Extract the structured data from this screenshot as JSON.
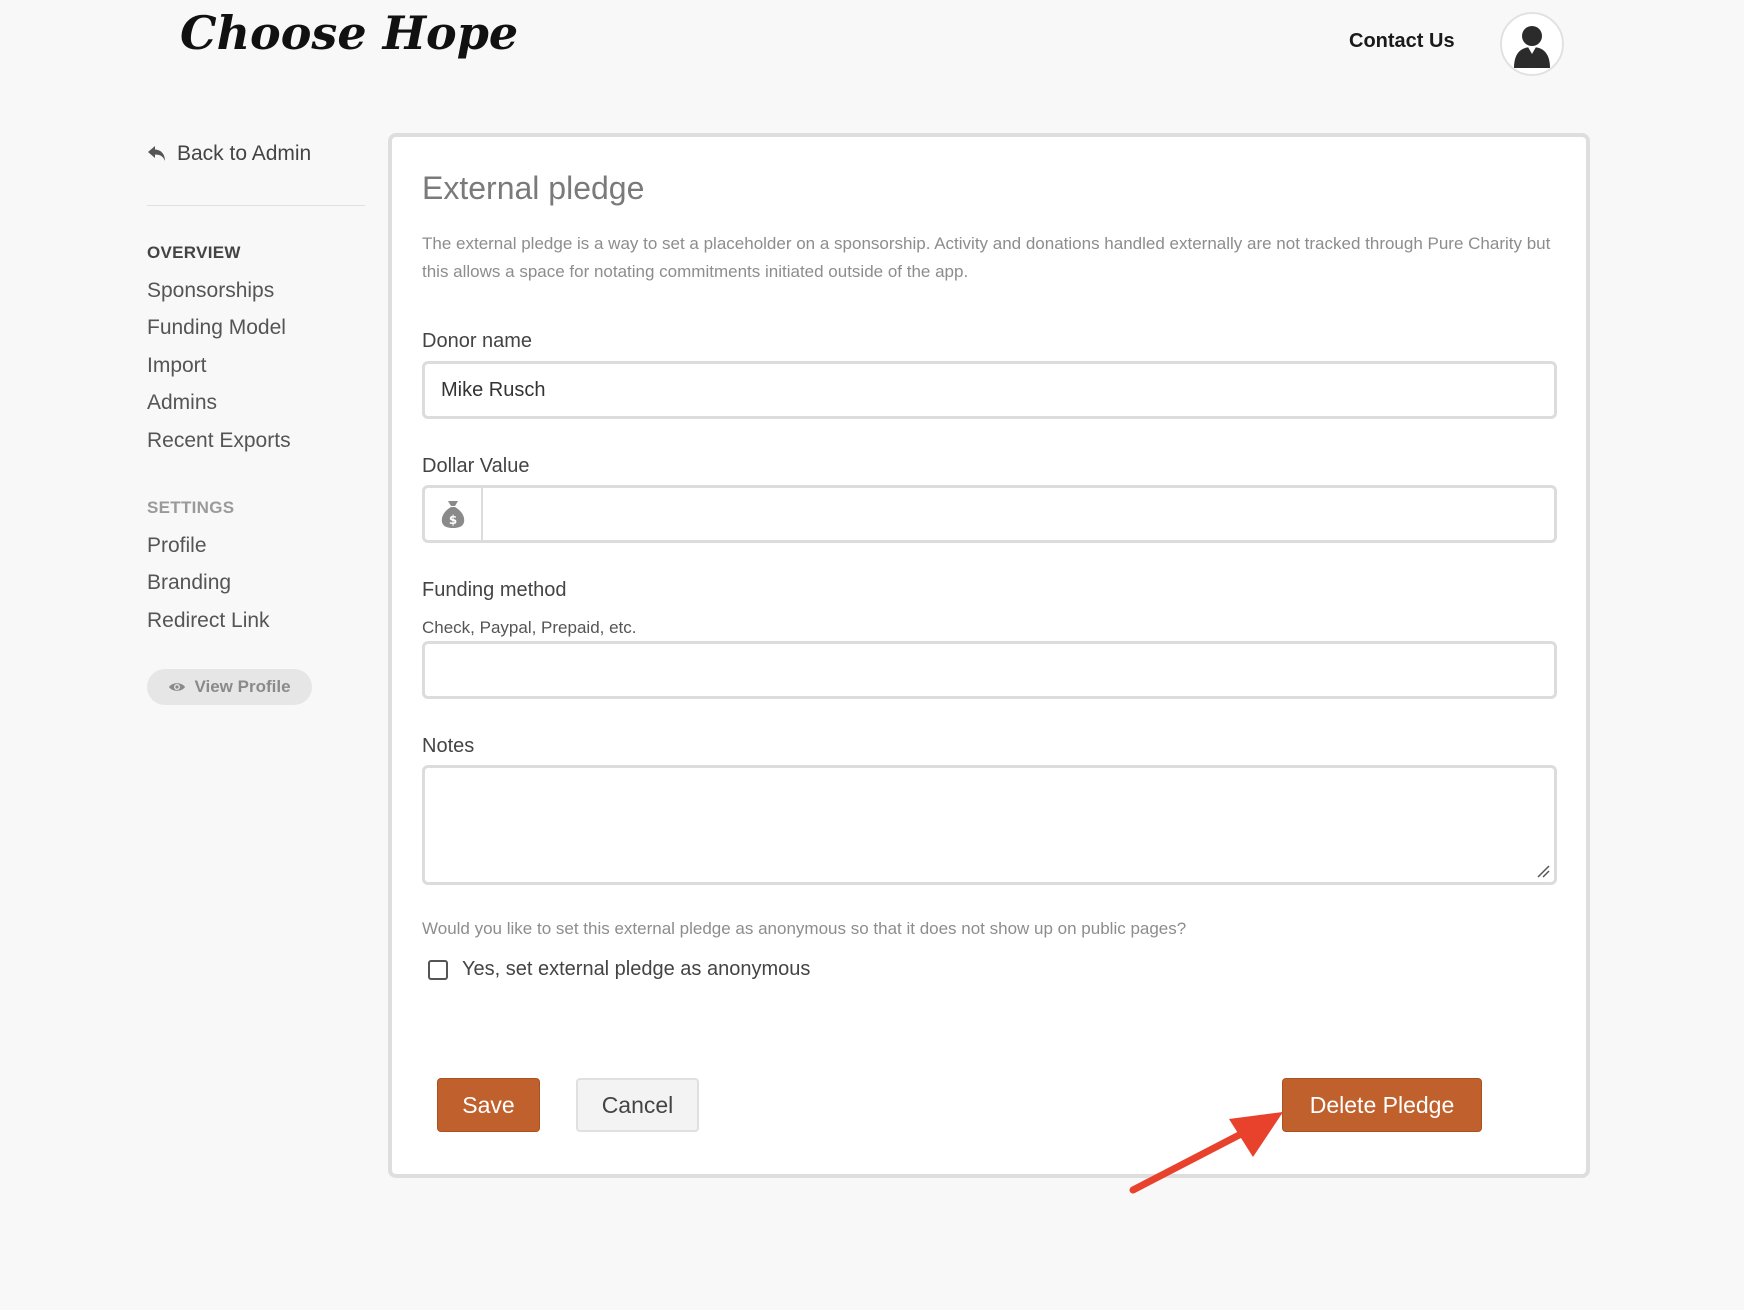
{
  "header": {
    "logo_text": "Choose Hope",
    "contact_label": "Contact Us"
  },
  "sidebar": {
    "back_label": "Back to Admin",
    "overview_title": "OVERVIEW",
    "overview_items": [
      "Sponsorships",
      "Funding Model",
      "Import",
      "Admins",
      "Recent Exports"
    ],
    "settings_title": "SETTINGS",
    "settings_items": [
      "Profile",
      "Branding",
      "Redirect Link"
    ],
    "view_profile_label": "View Profile"
  },
  "form": {
    "title": "External pledge",
    "description": "The external pledge is a way to set a placeholder on a sponsorship. Activity and donations handled externally are not tracked through Pure Charity but this allows a space for notating commitments initiated outside of the app.",
    "donor_label": "Donor name",
    "donor_value": "Mike Rusch",
    "dollar_label": "Dollar Value",
    "dollar_value": "",
    "funding_label": "Funding method",
    "funding_hint": "Check, Paypal, Prepaid, etc.",
    "funding_value": "",
    "notes_label": "Notes",
    "notes_value": "",
    "anon_question": "Would you like to set this external pledge as anonymous so that it does not show up on public pages?",
    "anon_checkbox_label": "Yes, set external pledge as anonymous",
    "anon_checked": false,
    "save_label": "Save",
    "cancel_label": "Cancel",
    "delete_label": "Delete Pledge"
  },
  "colors": {
    "accent": "#c0612d",
    "annotation_arrow": "#e8412c",
    "overview_title": "#444444",
    "settings_title": "#9a9a9a"
  },
  "icons": {
    "back": "undo-arrow-icon",
    "avatar": "user-silhouette-icon",
    "dollar": "money-bag-icon",
    "view_profile": "eye-icon"
  }
}
